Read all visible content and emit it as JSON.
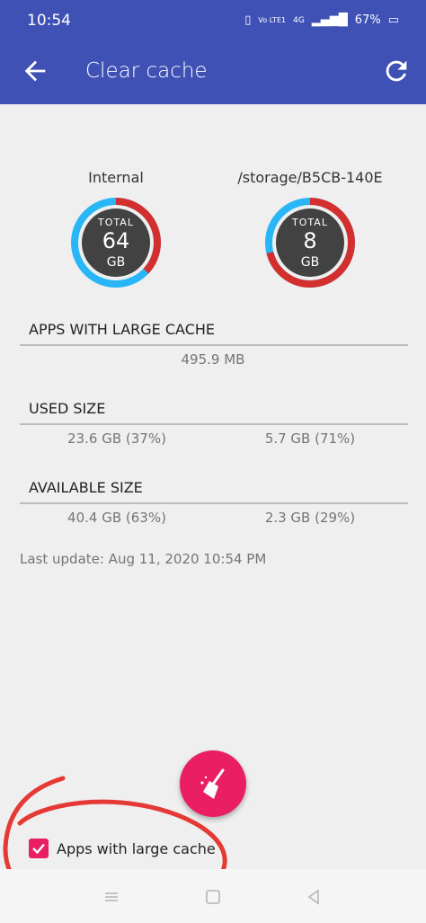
{
  "status_bar": {
    "time": "10:54",
    "signal_text": "Vo LTE1",
    "network": "4G",
    "battery": "67%"
  },
  "app_bar": {
    "title": "Clear cache",
    "back_icon": "arrow-back-icon",
    "refresh_icon": "refresh-icon"
  },
  "storages": [
    {
      "label": "Internal",
      "total_label": "TOTAL",
      "total_value": "64",
      "unit": "GB",
      "used_fraction": 0.37
    },
    {
      "label": "/storage/B5CB-140E",
      "total_label": "TOTAL",
      "total_value": "8",
      "unit": "GB",
      "used_fraction": 0.71
    }
  ],
  "sections": {
    "large_cache": {
      "title": "APPS WITH LARGE CACHE",
      "value": "495.9 MB"
    },
    "used_size": {
      "title": "USED SIZE",
      "internal": "23.6 GB (37%)",
      "external": "5.7 GB (71%)"
    },
    "available_size": {
      "title": "AVAILABLE SIZE",
      "internal": "40.4 GB (63%)",
      "external": "2.3 GB (29%)"
    }
  },
  "last_update": "Last update: Aug 11, 2020 10:54 PM",
  "option": {
    "label": "Apps with large cache",
    "checked": true
  },
  "colors": {
    "primary": "#3f51b5",
    "accent": "#e91e63",
    "used": "#d32f2f",
    "free": "#29b6f6",
    "annotation": "#e53935"
  }
}
